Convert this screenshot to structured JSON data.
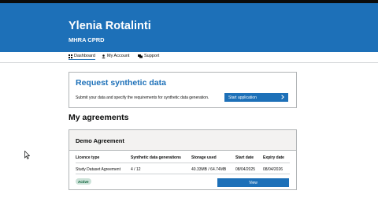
{
  "header": {
    "user_name": "Ylenia Rotalinti",
    "organisation": "MHRA CPRD"
  },
  "nav": {
    "items": [
      {
        "label": "Dashboard",
        "icon": "grid-icon",
        "active": true
      },
      {
        "label": "My Account",
        "icon": "person-icon",
        "active": false
      },
      {
        "label": "Support",
        "icon": "chat-icon",
        "active": false
      }
    ]
  },
  "request_card": {
    "title": "Request synthetic data",
    "description": "Submit your data and specify the requirements for synthetic data generation.",
    "button_label": "Start application",
    "button_icon": "chevron-right-icon"
  },
  "agreements": {
    "heading": "My agreements",
    "card": {
      "title": "Demo Agreement",
      "columns": [
        "Licence type",
        "Synthetic data generations",
        "Storage used",
        "Start date",
        "Expiry date"
      ],
      "row": [
        "Study Dataset Agreement",
        "4 / 12",
        "40.33MB / 64.74MB",
        "08/04/2025",
        "08/04/2026"
      ],
      "status": "Active",
      "view_label": "View"
    }
  },
  "colors": {
    "brand_blue": "#1d70b8",
    "status_green_bg": "#cce2d8",
    "status_green_text": "#005a30"
  }
}
